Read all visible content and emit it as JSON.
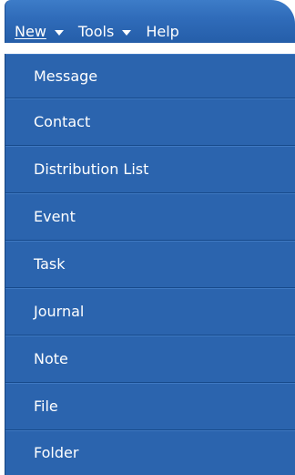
{
  "menubar": {
    "items": [
      {
        "label": "New"
      },
      {
        "label": "Tools"
      },
      {
        "label": "Help"
      }
    ]
  },
  "dropdown": {
    "items": [
      {
        "label": "Message"
      },
      {
        "label": "Contact"
      },
      {
        "label": "Distribution List"
      },
      {
        "label": "Event"
      },
      {
        "label": "Task"
      },
      {
        "label": "Journal"
      },
      {
        "label": "Note"
      },
      {
        "label": "File"
      },
      {
        "label": "Folder"
      }
    ]
  },
  "colors": {
    "menu_blue": "#2b64ae",
    "menubar_top": "#3d7cc8",
    "text": "#ffffff",
    "separator": "#174a8b"
  }
}
